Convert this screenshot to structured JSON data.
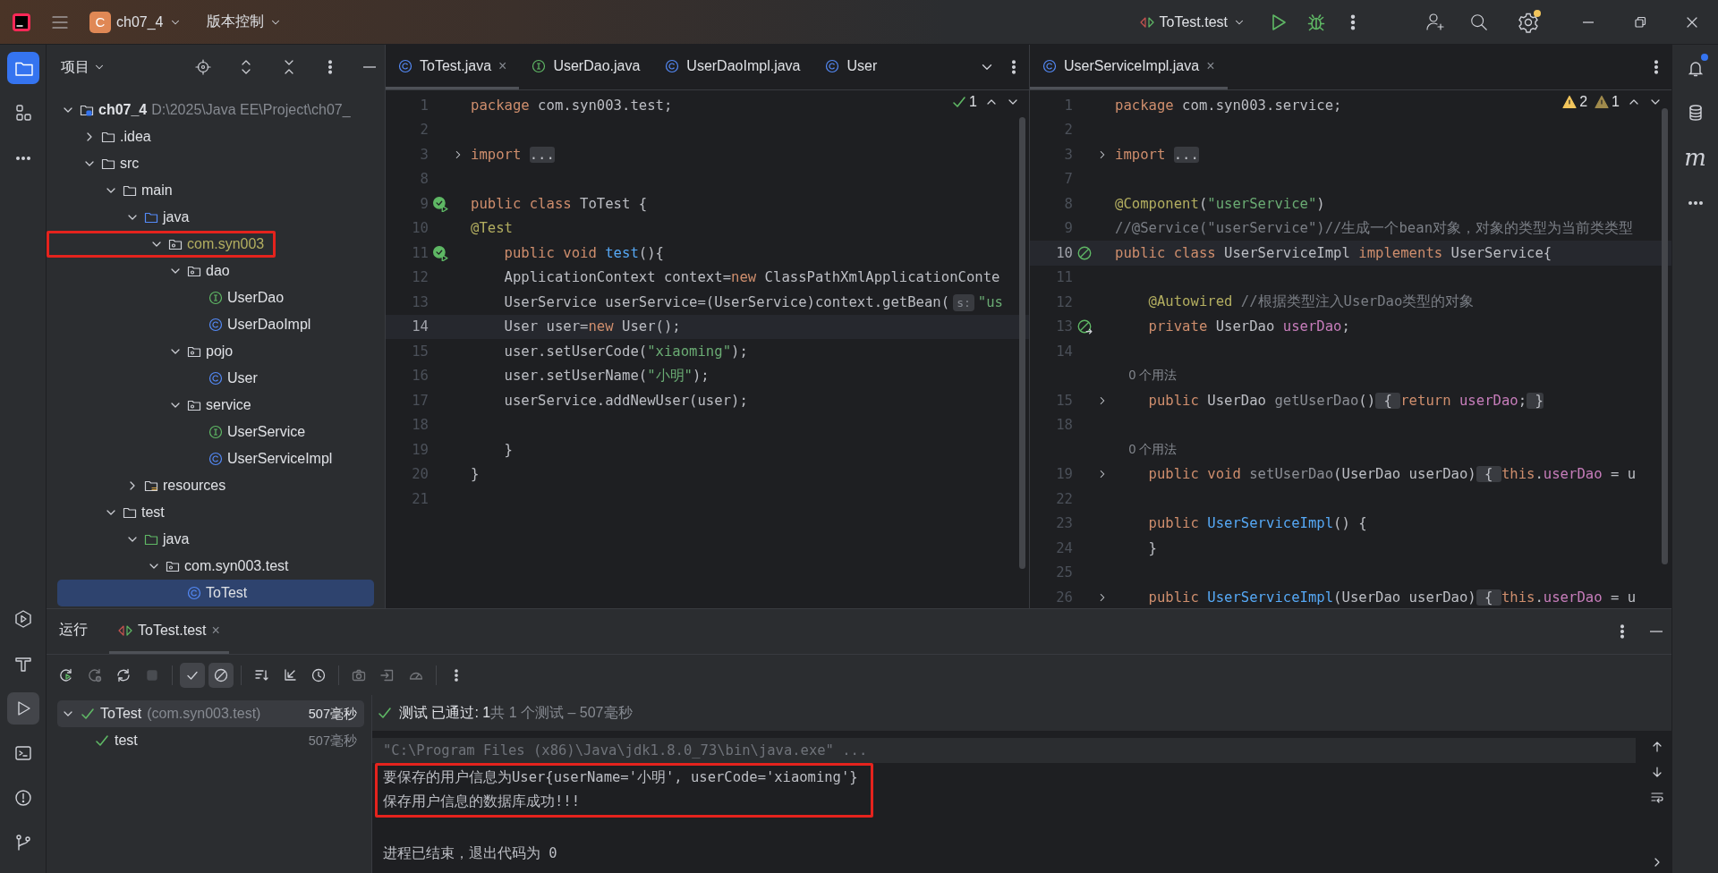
{
  "title_bar": {
    "project_badge": "C",
    "project": "ch07_4",
    "vcs": "版本控制",
    "run_config": "ToTest.test",
    "settings_badge": true
  },
  "left_toolbar": {
    "top": [
      {
        "kind": "project",
        "selected": true
      },
      {
        "kind": "structure",
        "selected": false
      },
      {
        "kind": "more",
        "selected": false
      }
    ],
    "bottom": [
      {
        "kind": "services",
        "selected": false
      },
      {
        "kind": "build",
        "selected": false
      },
      {
        "kind": "run",
        "selected": true
      },
      {
        "kind": "terminal",
        "selected": false
      },
      {
        "kind": "problems",
        "selected": false
      },
      {
        "kind": "git",
        "selected": false
      }
    ]
  },
  "right_toolbar": [
    {
      "kind": "notifications",
      "badge": true
    },
    {
      "kind": "database",
      "badge": false
    },
    {
      "kind": "maven",
      "glyph": "m",
      "badge": false
    },
    {
      "kind": "more",
      "badge": false
    }
  ],
  "project_panel": {
    "title": "项目",
    "tree": [
      {
        "label": "ch07_4",
        "hint": "D:\\2025\\Java EE\\Project\\ch07_",
        "kind": "module",
        "expanded": true,
        "selected": false,
        "children": [
          {
            "label": ".idea",
            "kind": "folder",
            "expanded": false,
            "selected": false
          },
          {
            "label": "src",
            "kind": "folder",
            "expanded": true,
            "selected": false,
            "children": [
              {
                "label": "main",
                "kind": "folder",
                "expanded": true,
                "selected": false,
                "children": [
                  {
                    "label": "java",
                    "kind": "source",
                    "expanded": true,
                    "selected": false,
                    "children": [
                      {
                        "label": "com.syn003",
                        "kind": "package",
                        "expanded": true,
                        "selected": false,
                        "annotated": true,
                        "children": [
                          {
                            "label": "dao",
                            "kind": "package",
                            "expanded": true,
                            "selected": false,
                            "children": [
                              {
                                "label": "UserDao",
                                "kind": "interface",
                                "selected": false
                              },
                              {
                                "label": "UserDaoImpl",
                                "kind": "class",
                                "selected": false
                              }
                            ]
                          },
                          {
                            "label": "pojo",
                            "kind": "package",
                            "expanded": true,
                            "selected": false,
                            "children": [
                              {
                                "label": "User",
                                "kind": "class",
                                "selected": false
                              }
                            ]
                          },
                          {
                            "label": "service",
                            "kind": "package",
                            "expanded": true,
                            "selected": false,
                            "children": [
                              {
                                "label": "UserService",
                                "kind": "interface",
                                "selected": false
                              },
                              {
                                "label": "UserServiceImpl",
                                "kind": "class",
                                "selected": false
                              }
                            ]
                          }
                        ]
                      }
                    ]
                  },
                  {
                    "label": "resources",
                    "kind": "resources",
                    "expanded": false,
                    "selected": false
                  }
                ]
              },
              {
                "label": "test",
                "kind": "folder",
                "expanded": true,
                "selected": false,
                "children": [
                  {
                    "label": "java",
                    "kind": "test-source",
                    "expanded": true,
                    "selected": false,
                    "children": [
                      {
                        "label": "com.syn003.test",
                        "kind": "package",
                        "expanded": true,
                        "selected": false,
                        "children": [
                          {
                            "label": "ToTest",
                            "kind": "class",
                            "selected": true
                          }
                        ]
                      }
                    ]
                  }
                ]
              }
            ]
          }
        ]
      }
    ]
  },
  "editors": [
    {
      "tabs": [
        {
          "label": "ToTest.java",
          "kind": "class",
          "selected": true,
          "close": "×"
        },
        {
          "label": "UserDao.java",
          "kind": "interface",
          "selected": false
        },
        {
          "label": "UserDaoImpl.java",
          "kind": "class",
          "selected": false
        },
        {
          "label": "User",
          "kind": "class",
          "selected": false
        }
      ],
      "tab_list": true,
      "inspections": [
        {
          "kind": "ok",
          "count": "1"
        }
      ],
      "lines": [
        {
          "kind": "code",
          "number": "1",
          "current": false,
          "folded": false,
          "tokens": [
            {
              "kind": "kw",
              "text": "package"
            },
            {
              "kind": "plain",
              "text": " com.syn003.test;"
            }
          ]
        },
        {
          "kind": "code",
          "number": "2",
          "current": false,
          "folded": false
        },
        {
          "kind": "code",
          "number": "3",
          "current": false,
          "folded": true,
          "tokens": [
            {
              "kind": "kw",
              "text": "import "
            },
            {
              "kind": "fold",
              "text": "..."
            }
          ]
        },
        {
          "kind": "code",
          "number": "8",
          "current": false,
          "folded": false
        },
        {
          "kind": "code",
          "number": "9",
          "current": false,
          "folded": false,
          "gutter": {
            "kind": "run"
          },
          "tokens": [
            {
              "kind": "kw",
              "text": "public class"
            },
            {
              "kind": "plain",
              "text": " ToTest {"
            }
          ]
        },
        {
          "kind": "code",
          "number": "10",
          "current": false,
          "folded": false,
          "tokens": [
            {
              "kind": "ann",
              "text": "@Test"
            }
          ]
        },
        {
          "kind": "code",
          "number": "11",
          "current": false,
          "folded": false,
          "gutter": {
            "kind": "run"
          },
          "tokens": [
            {
              "kind": "kw",
              "text": "    public void "
            },
            {
              "kind": "decl",
              "text": "test"
            },
            {
              "kind": "plain",
              "text": "(){"
            }
          ]
        },
        {
          "kind": "code",
          "number": "12",
          "current": false,
          "folded": false,
          "tokens": [
            {
              "kind": "plain",
              "text": "    ApplicationContext context="
            },
            {
              "kind": "kw",
              "text": "new"
            },
            {
              "kind": "plain",
              "text": " ClassPathXmlApplicationConte"
            }
          ]
        },
        {
          "kind": "code",
          "number": "13",
          "current": false,
          "folded": false,
          "tokens": [
            {
              "kind": "plain",
              "text": "    UserService userService=(UserService)context.getBean("
            },
            {
              "kind": "hint",
              "text": "s:"
            },
            {
              "kind": "str",
              "text": "\"us"
            }
          ]
        },
        {
          "kind": "code",
          "number": "14",
          "current": true,
          "folded": false,
          "tokens": [
            {
              "kind": "plain",
              "text": "    User user="
            },
            {
              "kind": "kw",
              "text": "new"
            },
            {
              "kind": "plain",
              "text": " User();"
            }
          ]
        },
        {
          "kind": "code",
          "number": "15",
          "current": false,
          "folded": false,
          "tokens": [
            {
              "kind": "plain",
              "text": "    user.setUserCode("
            },
            {
              "kind": "str",
              "text": "\"xiaoming\""
            },
            {
              "kind": "plain",
              "text": ");"
            }
          ]
        },
        {
          "kind": "code",
          "number": "16",
          "current": false,
          "folded": false,
          "tokens": [
            {
              "kind": "plain",
              "text": "    user.setUserName("
            },
            {
              "kind": "str",
              "text": "\"小明\""
            },
            {
              "kind": "plain",
              "text": ");"
            }
          ]
        },
        {
          "kind": "code",
          "number": "17",
          "current": false,
          "folded": false,
          "tokens": [
            {
              "kind": "plain",
              "text": "    userService.addNewUser(user);"
            }
          ]
        },
        {
          "kind": "code",
          "number": "18",
          "current": false,
          "folded": false
        },
        {
          "kind": "code",
          "number": "19",
          "current": false,
          "folded": false,
          "tokens": [
            {
              "kind": "plain",
              "text": "    }"
            }
          ]
        },
        {
          "kind": "code",
          "number": "20",
          "current": false,
          "folded": false,
          "tokens": [
            {
              "kind": "plain",
              "text": "}"
            }
          ]
        },
        {
          "kind": "code",
          "number": "21",
          "current": false,
          "folded": false
        }
      ]
    },
    {
      "tabs": [
        {
          "label": "UserServiceImpl.java",
          "kind": "class",
          "selected": true,
          "close": "×"
        }
      ],
      "tab_list": false,
      "inspections": [
        {
          "kind": "warning",
          "count": "2"
        },
        {
          "kind": "weak",
          "count": "1"
        }
      ],
      "lines": [
        {
          "kind": "code",
          "number": "1",
          "current": false,
          "folded": false,
          "tokens": [
            {
              "kind": "kw",
              "text": "package"
            },
            {
              "kind": "plain",
              "text": " com.syn003.service;"
            }
          ]
        },
        {
          "kind": "code",
          "number": "2",
          "current": false,
          "folded": false
        },
        {
          "kind": "code",
          "number": "3",
          "current": false,
          "folded": true,
          "tokens": [
            {
              "kind": "kw",
              "text": "import "
            },
            {
              "kind": "fold",
              "text": "..."
            }
          ]
        },
        {
          "kind": "code",
          "number": "7",
          "current": false,
          "folded": false
        },
        {
          "kind": "code",
          "number": "8",
          "current": false,
          "folded": false,
          "tokens": [
            {
              "kind": "ann",
              "text": "@Component"
            },
            {
              "kind": "plain",
              "text": "("
            },
            {
              "kind": "str",
              "text": "\"userService\""
            },
            {
              "kind": "plain",
              "text": ")"
            }
          ]
        },
        {
          "kind": "code",
          "number": "9",
          "current": false,
          "folded": false,
          "tokens": [
            {
              "kind": "comment",
              "text": "//@Service(\"userService\")//生成一个bean对象，对象的类型为当前类类型"
            }
          ]
        },
        {
          "kind": "code",
          "number": "10",
          "current": true,
          "folded": false,
          "gutter": {
            "kind": "bean"
          },
          "tokens": [
            {
              "kind": "kw",
              "text": "public class"
            },
            {
              "kind": "plain",
              "text": " UserServiceImpl "
            },
            {
              "kind": "kw",
              "text": "implements"
            },
            {
              "kind": "plain",
              "text": " UserService{"
            }
          ]
        },
        {
          "kind": "code",
          "number": "11",
          "current": false,
          "folded": false
        },
        {
          "kind": "code",
          "number": "12",
          "current": false,
          "folded": false,
          "tokens": [
            {
              "kind": "ann",
              "text": "    @Autowired"
            },
            {
              "kind": "comment",
              "text": " //根据类型注入UserDao类型的对象"
            }
          ]
        },
        {
          "kind": "code",
          "number": "13",
          "current": false,
          "folded": false,
          "gutter": {
            "kind": "bean-link"
          },
          "tokens": [
            {
              "kind": "kw",
              "text": "    private"
            },
            {
              "kind": "plain",
              "text": " UserDao "
            },
            {
              "kind": "field",
              "text": "userDao"
            },
            {
              "kind": "plain",
              "text": ";"
            }
          ]
        },
        {
          "kind": "code",
          "number": "14",
          "current": false,
          "folded": false
        },
        {
          "kind": "usages",
          "text": "0 个用法"
        },
        {
          "kind": "code",
          "number": "15",
          "current": false,
          "folded": true,
          "tokens": [
            {
              "kind": "kw",
              "text": "    public"
            },
            {
              "kind": "plain",
              "text": " UserDao "
            },
            {
              "kind": "unused",
              "text": "getUserDao"
            },
            {
              "kind": "plain",
              "text": "()"
            },
            {
              "kind": "fold",
              "text": " { "
            },
            {
              "kind": "kw",
              "text": "return"
            },
            {
              "kind": "field",
              "text": " userDao"
            },
            {
              "kind": "plain",
              "text": ";"
            },
            {
              "kind": "fold",
              "text": " }"
            }
          ]
        },
        {
          "kind": "code",
          "number": "18",
          "current": false,
          "folded": false
        },
        {
          "kind": "usages",
          "text": "0 个用法"
        },
        {
          "kind": "code",
          "number": "19",
          "current": false,
          "folded": true,
          "tokens": [
            {
              "kind": "kw",
              "text": "    public void "
            },
            {
              "kind": "unused",
              "text": "setUserDao"
            },
            {
              "kind": "plain",
              "text": "(UserDao userDao)"
            },
            {
              "kind": "fold",
              "text": " { "
            },
            {
              "kind": "kw",
              "text": "this"
            },
            {
              "kind": "plain",
              "text": "."
            },
            {
              "kind": "field",
              "text": "userDao"
            },
            {
              "kind": "plain",
              "text": " = u"
            }
          ]
        },
        {
          "kind": "code",
          "number": "22",
          "current": false,
          "folded": false
        },
        {
          "kind": "code",
          "number": "23",
          "current": false,
          "folded": false,
          "tokens": [
            {
              "kind": "kw",
              "text": "    public "
            },
            {
              "kind": "decl",
              "text": "UserServiceImpl"
            },
            {
              "kind": "plain",
              "text": "() {"
            }
          ]
        },
        {
          "kind": "code",
          "number": "24",
          "current": false,
          "folded": false,
          "tokens": [
            {
              "kind": "plain",
              "text": "    }"
            }
          ]
        },
        {
          "kind": "code",
          "number": "25",
          "current": false,
          "folded": false
        },
        {
          "kind": "code",
          "number": "26",
          "current": false,
          "folded": true,
          "tokens": [
            {
              "kind": "kw",
              "text": "    public "
            },
            {
              "kind": "decl",
              "text": "UserServiceImpl"
            },
            {
              "kind": "plain",
              "text": "(UserDao userDao)"
            },
            {
              "kind": "fold",
              "text": " { "
            },
            {
              "kind": "kw",
              "text": "this"
            },
            {
              "kind": "plain",
              "text": "."
            },
            {
              "kind": "field",
              "text": "userDao"
            },
            {
              "kind": "plain",
              "text": " = u"
            }
          ]
        }
      ]
    }
  ],
  "run_panel": {
    "tabs": [
      {
        "label": "运行",
        "kind": "title",
        "selected": false
      },
      {
        "label": "ToTest.test",
        "kind": "run",
        "selected": true,
        "close": "×"
      }
    ],
    "toolbar": [
      {
        "kind": "rerun",
        "disabled": false,
        "selected": false
      },
      {
        "kind": "rerun-failed",
        "disabled": true,
        "selected": false
      },
      {
        "kind": "toggle-auto",
        "disabled": false,
        "selected": false
      },
      {
        "kind": "stop",
        "disabled": true,
        "selected": false
      },
      {
        "kind": "show-passed",
        "disabled": false,
        "selected": true
      },
      {
        "kind": "show-ignored",
        "disabled": false,
        "selected": true
      },
      {
        "kind": "sort",
        "disabled": false,
        "selected": false
      },
      {
        "kind": "collapse",
        "disabled": false,
        "selected": false
      },
      {
        "kind": "history",
        "disabled": false,
        "selected": false
      },
      {
        "kind": "camera",
        "disabled": true,
        "selected": false
      },
      {
        "kind": "import",
        "disabled": true,
        "selected": false
      },
      {
        "kind": "gauge",
        "disabled": true,
        "selected": false
      },
      {
        "kind": "more",
        "disabled": false,
        "selected": false
      }
    ],
    "test_tree": [
      {
        "label": "ToTest",
        "detail": "(com.syn003.test)",
        "time": "507毫秒",
        "passed": true,
        "expanded": true,
        "selected": true,
        "children": [
          {
            "label": "test",
            "time": "507毫秒",
            "passed": true,
            "selected": false
          }
        ]
      }
    ],
    "status": {
      "passed": "测试 已通过: 1",
      "summary": "共 1 个测试 – 507毫秒"
    },
    "console": {
      "command": "\"C:\\Program Files (x86)\\Java\\jdk1.8.0_73\\bin\\java.exe\" ...",
      "output": {
        "annotated": true,
        "lines": [
          "要保存的用户信息为User{userName='小明', userCode='xiaoming'}",
          "保存用户信息的数据库成功!!!"
        ]
      },
      "exit": "进程已结束，退出代码为 0"
    }
  }
}
